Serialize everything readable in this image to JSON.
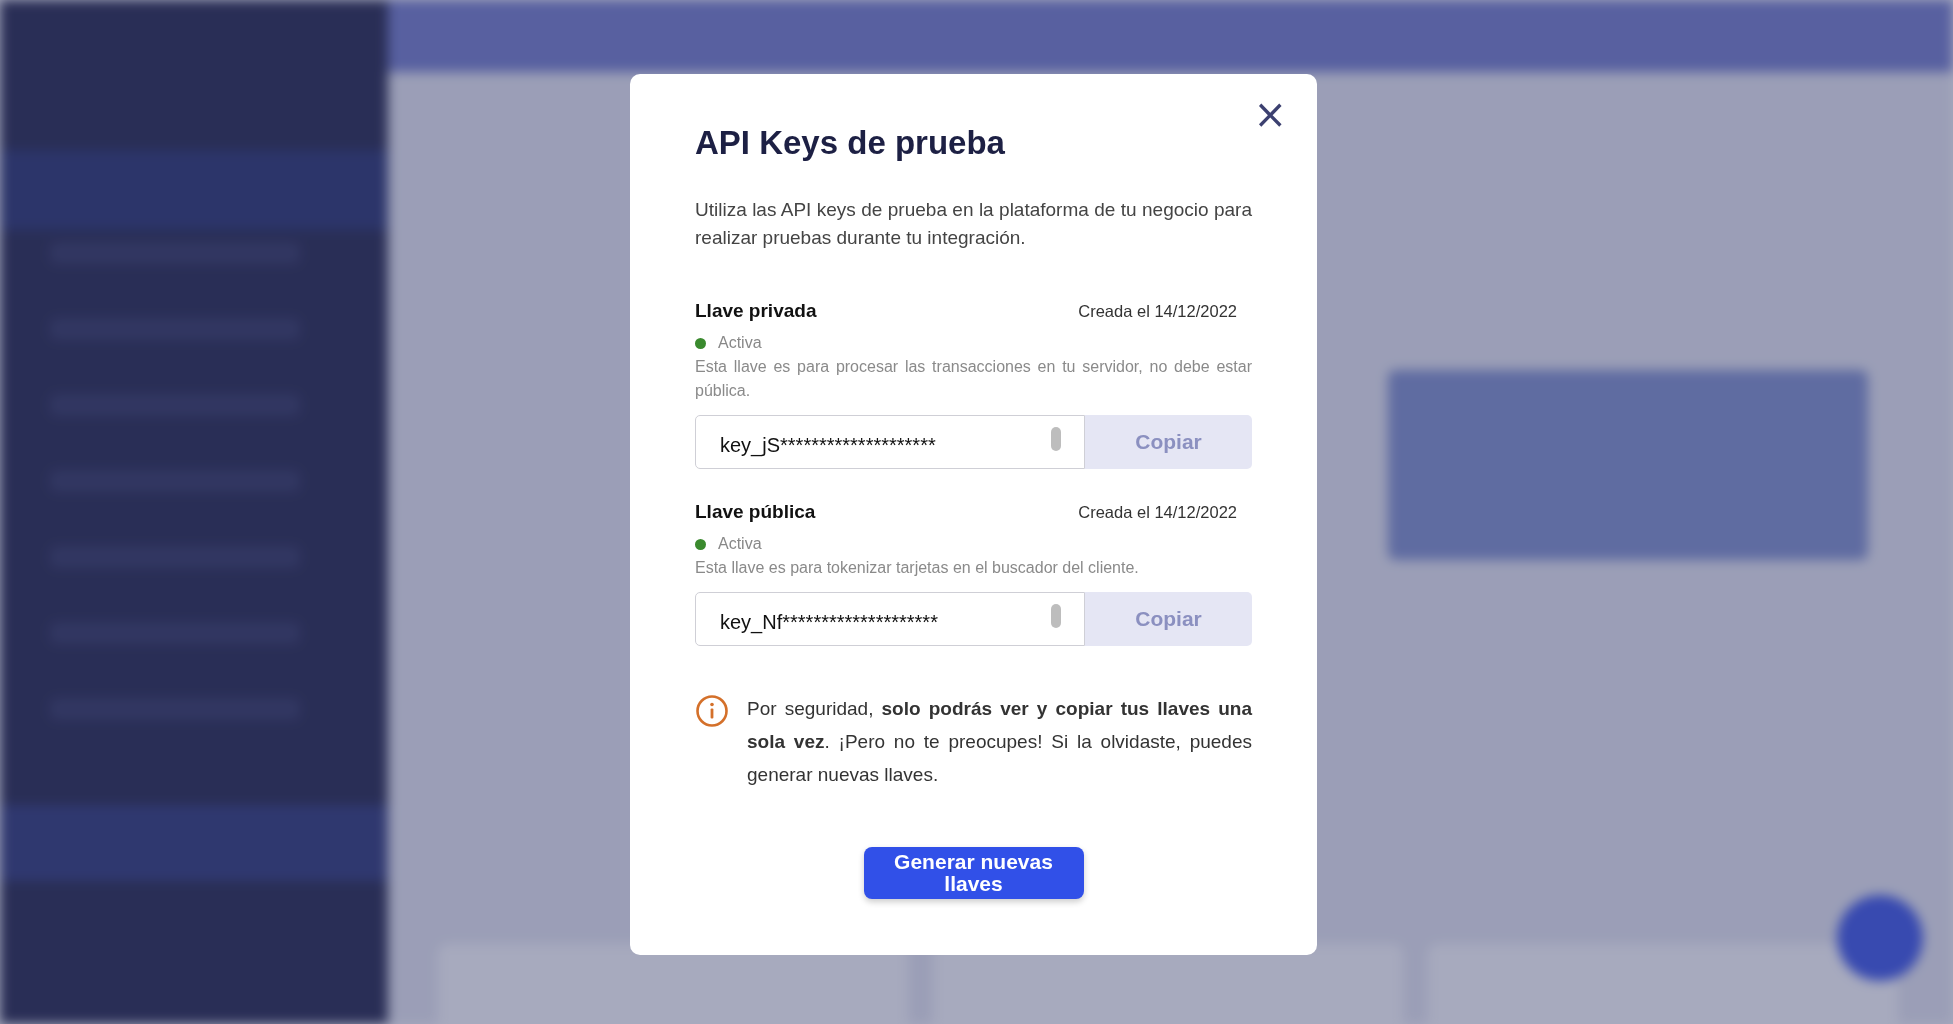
{
  "modal": {
    "title": "API Keys de prueba",
    "close": "×",
    "description": "Utiliza las API keys de prueba en la plataforma de tu negocio para realizar pruebas durante tu integración.",
    "keys": [
      {
        "name": "Llave privada",
        "created": "Creada el 14/12/2022",
        "status": "Activa",
        "active": true,
        "color": "#3a8a2e",
        "note": "Esta llave es para procesar las transacciones en tu servidor, no debe estar pública.",
        "value": "key_jS********************",
        "copy": "Copiar"
      },
      {
        "name": "Llave pública",
        "created": "Creada el 14/12/2022",
        "status": "Activa",
        "active": true,
        "color": "#3a8a2e",
        "note": "Esta llave es para tokenizar tarjetas en el buscador del cliente.",
        "value": "key_Nf********************",
        "copy": "Copiar"
      }
    ],
    "notice": "Por seguridad, **solo podrás ver y copiar tus llaves una sola vez**. ¡Pero no te preocupes! Si la olvidaste, puedes generar nuevas llaves.",
    "button": "Generar nuevas llaves"
  }
}
